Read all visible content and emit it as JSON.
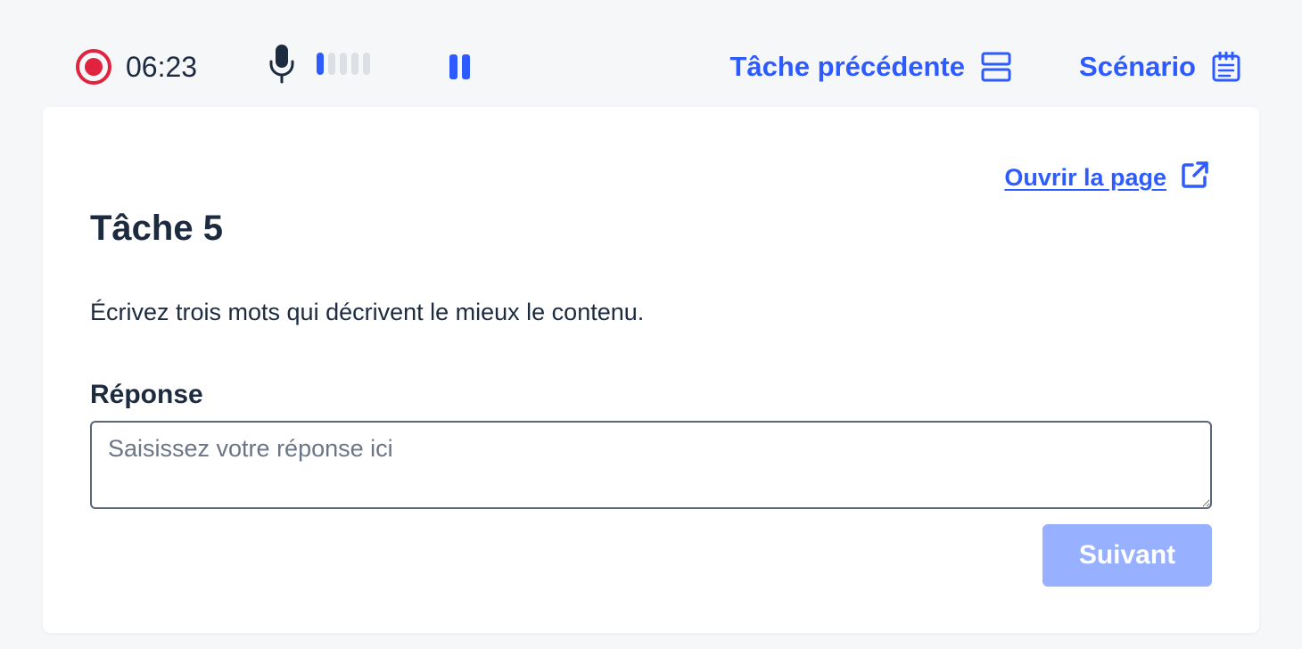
{
  "recorder": {
    "timer": "06:23",
    "mic_level_bars": 5,
    "mic_level_active": 1,
    "record_icon": "record-icon",
    "mic_icon": "microphone-icon",
    "pause_icon": "pause-icon"
  },
  "nav": {
    "previous_task": "Tâche précédente",
    "previous_task_icon": "split-panels-icon",
    "scenario": "Scénario",
    "scenario_icon": "notepad-icon"
  },
  "task": {
    "open_page": "Ouvrir la page",
    "open_page_icon": "external-link-icon",
    "title": "Tâche 5",
    "instruction": "Écrivez trois mots qui décrivent le mieux le contenu.",
    "answer_label": "Réponse",
    "answer_value": "",
    "answer_placeholder": "Saisissez votre réponse ici",
    "next_label": "Suivant"
  },
  "colors": {
    "accent": "#2e5bff",
    "record": "#e0243f",
    "text": "#1c2b3f",
    "button_disabled": "#97b0ff",
    "background": "#f6f7f9"
  }
}
